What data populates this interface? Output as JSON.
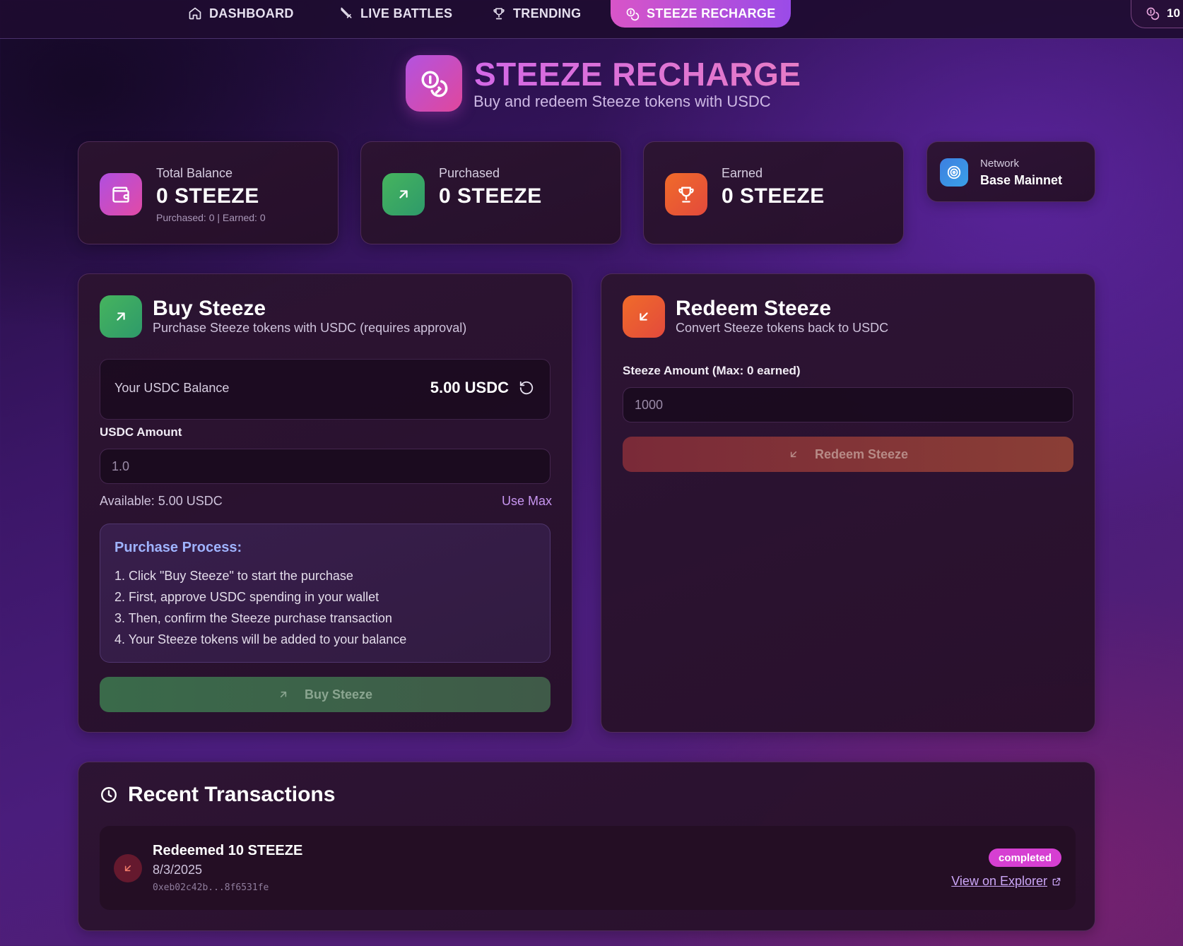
{
  "nav": {
    "items": [
      {
        "label": "DASHBOARD",
        "icon": "home-icon"
      },
      {
        "label": "LIVE BATTLES",
        "icon": "sword-icon"
      },
      {
        "label": "TRENDING",
        "icon": "trophy-icon"
      },
      {
        "label": "STEEZE RECHARGE",
        "icon": "coins-icon",
        "active": true
      }
    ],
    "coin_balance": "10"
  },
  "header": {
    "title": "STEEZE RECHARGE",
    "subtitle": "Buy and redeem Steeze tokens with USDC"
  },
  "stats": {
    "total": {
      "label": "Total Balance",
      "value": "0 STEEZE",
      "sub": "Purchased: 0 | Earned: 0"
    },
    "purchased": {
      "label": "Purchased",
      "value": "0 STEEZE"
    },
    "earned": {
      "label": "Earned",
      "value": "0 STEEZE"
    },
    "network": {
      "label": "Network",
      "value": "Base Mainnet"
    }
  },
  "buy": {
    "title": "Buy Steeze",
    "subtitle": "Purchase Steeze tokens with USDC (requires approval)",
    "balance_label": "Your USDC Balance",
    "balance_value": "5.00 USDC",
    "amount_label": "USDC Amount",
    "amount_placeholder": "1.0",
    "available": "Available: 5.00 USDC",
    "use_max": "Use Max",
    "process_title": "Purchase Process:",
    "steps": [
      "1. Click \"Buy Steeze\" to start the purchase",
      "2. First, approve USDC spending in your wallet",
      "3. Then, confirm the Steeze purchase transaction",
      "4. Your Steeze tokens will be added to your balance"
    ],
    "button": "Buy Steeze"
  },
  "redeem": {
    "title": "Redeem Steeze",
    "subtitle": "Convert Steeze tokens back to USDC",
    "amount_label": "Steeze Amount (Max: 0 earned)",
    "amount_placeholder": "1000",
    "button": "Redeem Steeze"
  },
  "transactions": {
    "title": "Recent Transactions",
    "items": [
      {
        "title": "Redeemed 10 STEEZE",
        "date": "8/3/2025",
        "hash": "0xeb02c42b...8f6531fe",
        "status": "completed",
        "link": "View on Explorer"
      }
    ]
  },
  "colors": {
    "accent_pink": "#d855c8",
    "accent_purple": "#9a4be8",
    "green": "#46b45e",
    "orange": "#f06b2a",
    "status_badge": "#d63fd2"
  }
}
